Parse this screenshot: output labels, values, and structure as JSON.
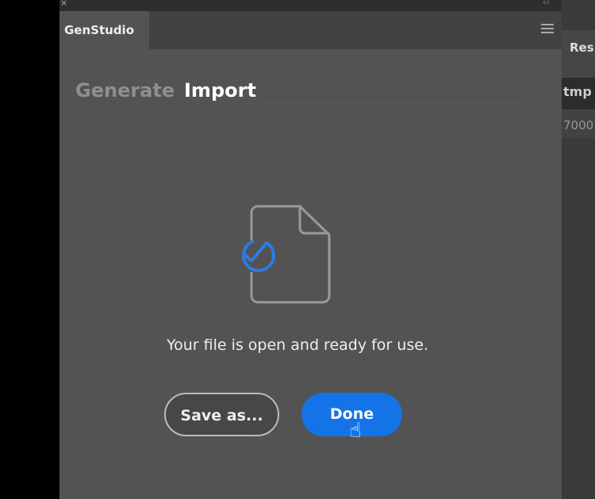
{
  "panel": {
    "tab": "GenStudio",
    "tabs": [
      {
        "label": "Generate",
        "active": false
      },
      {
        "label": "Import",
        "active": true
      }
    ],
    "message": "Your file is open and ready for use.",
    "buttons": {
      "save_as": "Save as...",
      "done": "Done"
    },
    "accent": "#1473e6"
  },
  "right_panel": {
    "tab": "Res",
    "row1": "tmp",
    "row2": "7000"
  }
}
